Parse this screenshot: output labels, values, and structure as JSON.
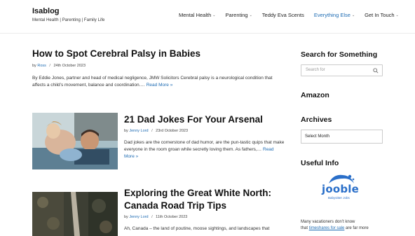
{
  "site": {
    "title": "Isablog",
    "tagline": "Mental Health | Parenting | Family Life"
  },
  "nav": {
    "items": [
      {
        "label": "Mental Health",
        "has_dropdown": true
      },
      {
        "label": "Parenting",
        "has_dropdown": true
      },
      {
        "label": "Teddy Eva Scents",
        "has_dropdown": false
      },
      {
        "label": "Everything Else",
        "has_dropdown": true,
        "active": true
      },
      {
        "label": "Get In Touch",
        "has_dropdown": true
      }
    ],
    "chevron": "⌄",
    "active_color": "#1d6bb3"
  },
  "posts": [
    {
      "title": "How to Spot Cerebral Palsy in Babies",
      "by": "by",
      "author": "Ross",
      "date": "24th October 2023",
      "excerpt": "By Eddie Jones, partner and head of medical negligence, JMW Solicitors Cerebral palsy is a neurological condition that affects a child’s movement, balance and coordination.…",
      "read_more": "Read More »"
    },
    {
      "title": "21 Dad Jokes For Your Arsenal",
      "by": "by",
      "author": "Jenny Lord",
      "date": "23rd October 2023",
      "excerpt": "Dad jokes are the cornerstone of dad humor, are the pun-tastic quips that make everyone in the room groan while secretly loving them. As fathers,…",
      "read_more": "Read More »",
      "image": "father-and-children-playing-photo"
    },
    {
      "title_line1": "Exploring the Great White North:",
      "title_line2": "Canada Road Trip Tips",
      "by": "by",
      "author": "Jenny Lord",
      "date": "11th October 2023",
      "excerpt": "Ah, Canada – the land of poutine, moose sightings, and landscapes that",
      "image": "aerial-forest-road-photo"
    }
  ],
  "sidebar": {
    "search_title": "Search for Something",
    "search_placeholder": "Search for",
    "search_icon": "search-icon",
    "amazon_title": "Amazon",
    "archives_title": "Archives",
    "archives_select": "Select Month",
    "useful_title": "Useful Info",
    "jooble_logo": "jooble",
    "jooble_tagline": "Babysitter Jobs",
    "info_text_1": "Many vacationers don’t know",
    "info_text_2a": "that",
    "info_link": "timeshares for sale",
    "info_text_2b": "are far more"
  },
  "colors": {
    "link": "#1d6bb3",
    "text": "#222222",
    "jooble_blue": "#2a6fc9"
  }
}
